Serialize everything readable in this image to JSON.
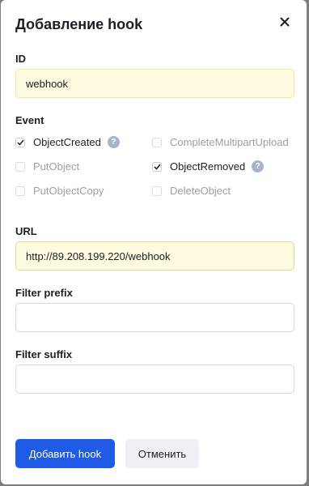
{
  "dialog": {
    "title": "Добавление hook",
    "close_icon": "close-icon"
  },
  "fields": {
    "id": {
      "label": "ID",
      "value": "webhook"
    },
    "url": {
      "label": "URL",
      "value": "http://89.208.199.220/webhook"
    },
    "filter_prefix": {
      "label": "Filter prefix",
      "value": ""
    },
    "filter_suffix": {
      "label": "Filter suffix",
      "value": ""
    }
  },
  "event": {
    "label": "Event",
    "options": [
      {
        "label": "ObjectCreated",
        "checked": true,
        "help": true
      },
      {
        "label": "CompleteMultipartUpload",
        "checked": false,
        "help": false
      },
      {
        "label": "PutObject",
        "checked": false,
        "help": false
      },
      {
        "label": "ObjectRemoved",
        "checked": true,
        "help": true
      },
      {
        "label": "PutObjectCopy",
        "checked": false,
        "help": false
      },
      {
        "label": "DeleteObject",
        "checked": false,
        "help": false
      }
    ],
    "help_glyph": "?"
  },
  "actions": {
    "submit_label": "Добавить hook",
    "cancel_label": "Отменить"
  }
}
